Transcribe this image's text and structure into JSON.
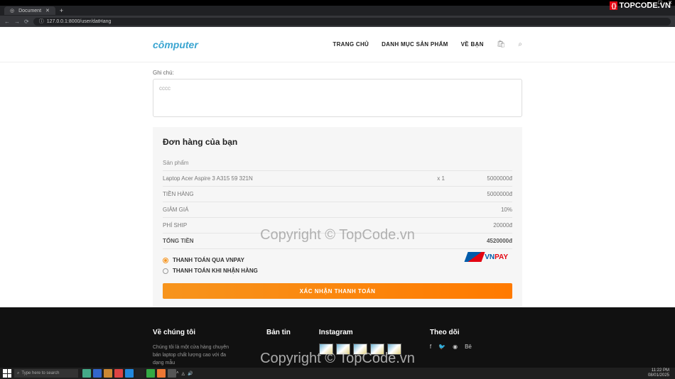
{
  "browser": {
    "tab_title": "Document",
    "url": "127.0.0.1:8000/user/datHang"
  },
  "header": {
    "logo_text": "cômputer",
    "nav": {
      "home": "TRANG CHỦ",
      "catalog": "DANH MỤC SẢN PHẨM",
      "about": "VỀ BẠN"
    }
  },
  "checkout": {
    "note_label": "Ghi chú:",
    "note_value": "cccc",
    "order_title": "Đơn hàng của bạn",
    "headers": {
      "product": "Sản phẩm"
    },
    "items": [
      {
        "name": "Laptop Acer Aspire 3 A315 59 321N",
        "qty": "x 1",
        "price": "5000000đ"
      }
    ],
    "summary": {
      "subtotal_label": "TIỀN HÀNG",
      "subtotal_value": "5000000đ",
      "discount_label": "GIẢM GIÁ",
      "discount_value": "10%",
      "ship_label": "PHÍ SHIP",
      "ship_value": "20000đ",
      "total_label": "TỔNG TIỀN",
      "total_value": "4520000đ"
    },
    "payment": {
      "vnpay": "THANH TOÁN QUA VNPAY",
      "cod": "THANH TOÁN KHI NHẬN HÀNG",
      "logo_text_1": "VN",
      "logo_text_2": "PAY"
    },
    "confirm_button": "XÁC NHẬN THANH TOÁN"
  },
  "footer": {
    "about_title": "Về chúng tôi",
    "about_text": "Chúng tôi là một cửa hàng chuyên bán laptop chất lượng cao với đa dạng mẫu",
    "news_title": "Bản tin",
    "insta_title": "Instagram",
    "follow_title": "Theo dõi"
  },
  "watermark": {
    "brand": "TOPCODE.VN",
    "copyright": "Copyright © TopCode.vn"
  },
  "taskbar": {
    "search_placeholder": "Type here to search",
    "time": "11:22 PM",
    "date": "08/01/2025"
  }
}
